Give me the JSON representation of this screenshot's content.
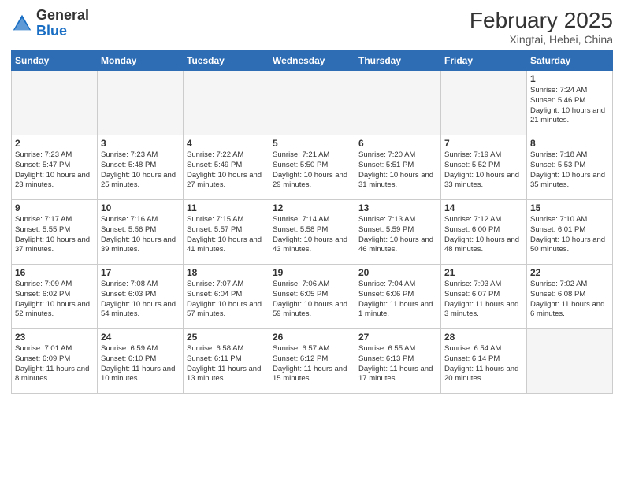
{
  "header": {
    "logo_general": "General",
    "logo_blue": "Blue",
    "month_year": "February 2025",
    "location": "Xingtai, Hebei, China"
  },
  "weekdays": [
    "Sunday",
    "Monday",
    "Tuesday",
    "Wednesday",
    "Thursday",
    "Friday",
    "Saturday"
  ],
  "weeks": [
    [
      {
        "day": "",
        "info": ""
      },
      {
        "day": "",
        "info": ""
      },
      {
        "day": "",
        "info": ""
      },
      {
        "day": "",
        "info": ""
      },
      {
        "day": "",
        "info": ""
      },
      {
        "day": "",
        "info": ""
      },
      {
        "day": "1",
        "info": "Sunrise: 7:24 AM\nSunset: 5:46 PM\nDaylight: 10 hours and 21 minutes."
      }
    ],
    [
      {
        "day": "2",
        "info": "Sunrise: 7:23 AM\nSunset: 5:47 PM\nDaylight: 10 hours and 23 minutes."
      },
      {
        "day": "3",
        "info": "Sunrise: 7:23 AM\nSunset: 5:48 PM\nDaylight: 10 hours and 25 minutes."
      },
      {
        "day": "4",
        "info": "Sunrise: 7:22 AM\nSunset: 5:49 PM\nDaylight: 10 hours and 27 minutes."
      },
      {
        "day": "5",
        "info": "Sunrise: 7:21 AM\nSunset: 5:50 PM\nDaylight: 10 hours and 29 minutes."
      },
      {
        "day": "6",
        "info": "Sunrise: 7:20 AM\nSunset: 5:51 PM\nDaylight: 10 hours and 31 minutes."
      },
      {
        "day": "7",
        "info": "Sunrise: 7:19 AM\nSunset: 5:52 PM\nDaylight: 10 hours and 33 minutes."
      },
      {
        "day": "8",
        "info": "Sunrise: 7:18 AM\nSunset: 5:53 PM\nDaylight: 10 hours and 35 minutes."
      }
    ],
    [
      {
        "day": "9",
        "info": "Sunrise: 7:17 AM\nSunset: 5:55 PM\nDaylight: 10 hours and 37 minutes."
      },
      {
        "day": "10",
        "info": "Sunrise: 7:16 AM\nSunset: 5:56 PM\nDaylight: 10 hours and 39 minutes."
      },
      {
        "day": "11",
        "info": "Sunrise: 7:15 AM\nSunset: 5:57 PM\nDaylight: 10 hours and 41 minutes."
      },
      {
        "day": "12",
        "info": "Sunrise: 7:14 AM\nSunset: 5:58 PM\nDaylight: 10 hours and 43 minutes."
      },
      {
        "day": "13",
        "info": "Sunrise: 7:13 AM\nSunset: 5:59 PM\nDaylight: 10 hours and 46 minutes."
      },
      {
        "day": "14",
        "info": "Sunrise: 7:12 AM\nSunset: 6:00 PM\nDaylight: 10 hours and 48 minutes."
      },
      {
        "day": "15",
        "info": "Sunrise: 7:10 AM\nSunset: 6:01 PM\nDaylight: 10 hours and 50 minutes."
      }
    ],
    [
      {
        "day": "16",
        "info": "Sunrise: 7:09 AM\nSunset: 6:02 PM\nDaylight: 10 hours and 52 minutes."
      },
      {
        "day": "17",
        "info": "Sunrise: 7:08 AM\nSunset: 6:03 PM\nDaylight: 10 hours and 54 minutes."
      },
      {
        "day": "18",
        "info": "Sunrise: 7:07 AM\nSunset: 6:04 PM\nDaylight: 10 hours and 57 minutes."
      },
      {
        "day": "19",
        "info": "Sunrise: 7:06 AM\nSunset: 6:05 PM\nDaylight: 10 hours and 59 minutes."
      },
      {
        "day": "20",
        "info": "Sunrise: 7:04 AM\nSunset: 6:06 PM\nDaylight: 11 hours and 1 minute."
      },
      {
        "day": "21",
        "info": "Sunrise: 7:03 AM\nSunset: 6:07 PM\nDaylight: 11 hours and 3 minutes."
      },
      {
        "day": "22",
        "info": "Sunrise: 7:02 AM\nSunset: 6:08 PM\nDaylight: 11 hours and 6 minutes."
      }
    ],
    [
      {
        "day": "23",
        "info": "Sunrise: 7:01 AM\nSunset: 6:09 PM\nDaylight: 11 hours and 8 minutes."
      },
      {
        "day": "24",
        "info": "Sunrise: 6:59 AM\nSunset: 6:10 PM\nDaylight: 11 hours and 10 minutes."
      },
      {
        "day": "25",
        "info": "Sunrise: 6:58 AM\nSunset: 6:11 PM\nDaylight: 11 hours and 13 minutes."
      },
      {
        "day": "26",
        "info": "Sunrise: 6:57 AM\nSunset: 6:12 PM\nDaylight: 11 hours and 15 minutes."
      },
      {
        "day": "27",
        "info": "Sunrise: 6:55 AM\nSunset: 6:13 PM\nDaylight: 11 hours and 17 minutes."
      },
      {
        "day": "28",
        "info": "Sunrise: 6:54 AM\nSunset: 6:14 PM\nDaylight: 11 hours and 20 minutes."
      },
      {
        "day": "",
        "info": ""
      }
    ]
  ]
}
